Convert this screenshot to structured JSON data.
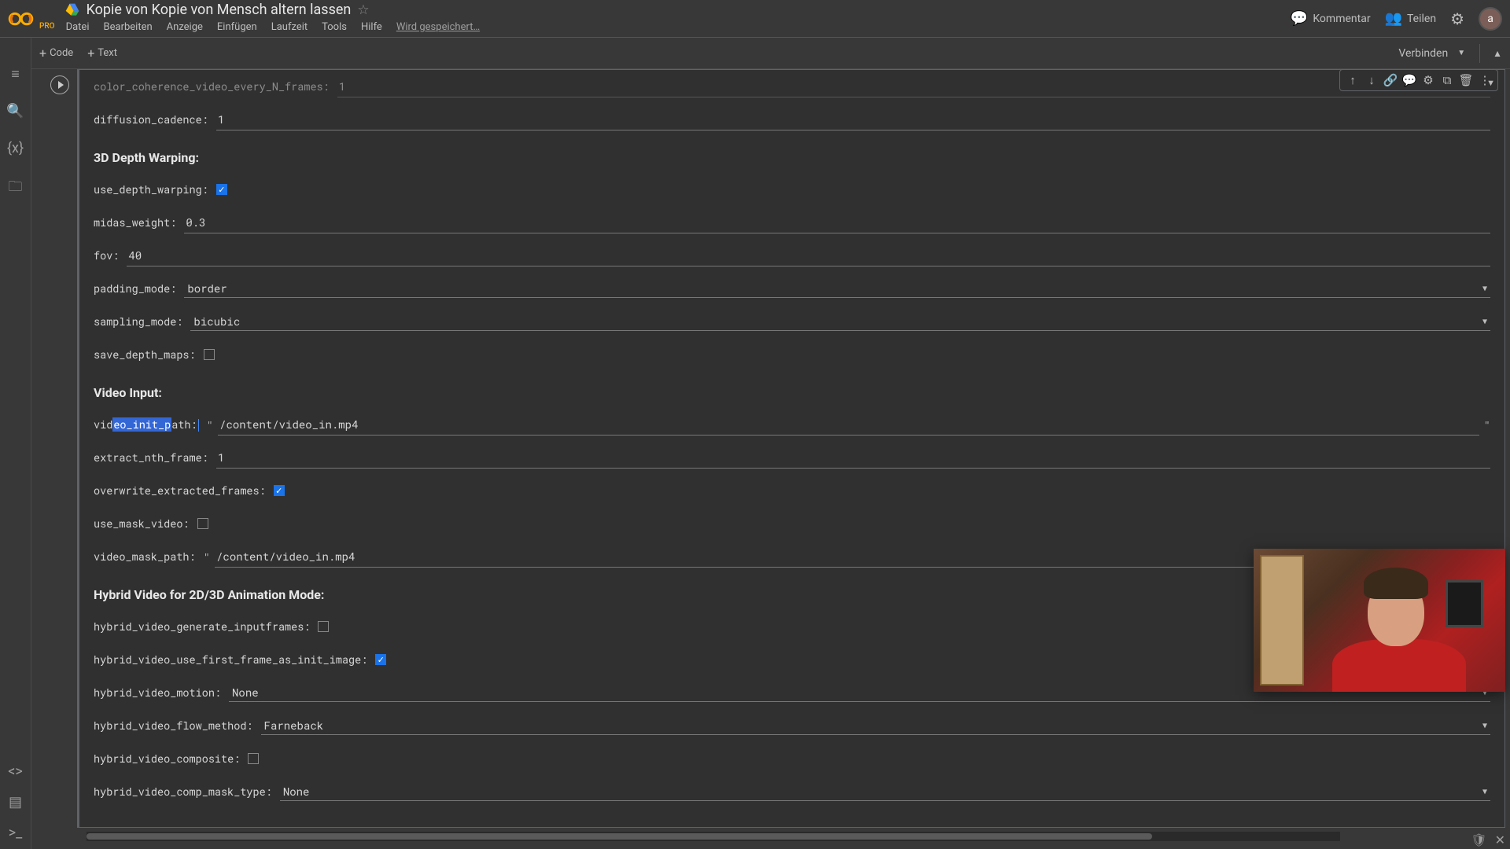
{
  "header": {
    "pro": "PRO",
    "title": "Kopie von Kopie von Mensch altern lassen",
    "menus": [
      "Datei",
      "Bearbeiten",
      "Anzeige",
      "Einfügen",
      "Laufzeit",
      "Tools",
      "Hilfe"
    ],
    "saving": "Wird gespeichert…",
    "kommentar": "Kommentar",
    "teilen": "Teilen",
    "avatar": "a"
  },
  "subbar": {
    "code": "Code",
    "text": "Text",
    "connect": "Verbinden"
  },
  "sections": {
    "depth": "3D Depth Warping:",
    "video": "Video Input:",
    "hybrid": "Hybrid Video for 2D/3D Animation Mode:"
  },
  "fields": {
    "color_coherence_label": "color_coherence_video_every_N_frames:",
    "color_coherence_value": "1",
    "diffusion_cadence_label": "diffusion_cadence:",
    "diffusion_cadence_value": "1",
    "use_depth_warping_label": "use_depth_warping:",
    "midas_weight_label": "midas_weight:",
    "midas_weight_value": "0.3",
    "fov_label": "fov:",
    "fov_value": "40",
    "padding_mode_label": "padding_mode:",
    "padding_mode_value": "border",
    "sampling_mode_label": "sampling_mode:",
    "sampling_mode_value": "bicubic",
    "save_depth_maps_label": "save_depth_maps:",
    "video_init_path_pre": "vid",
    "video_init_path_sel": "eo_init_p",
    "video_init_path_post": "ath:",
    "video_init_path_value": "/content/video_in.mp4",
    "extract_nth_frame_label": "extract_nth_frame:",
    "extract_nth_frame_value": "1",
    "overwrite_extracted_frames_label": "overwrite_extracted_frames:",
    "use_mask_video_label": "use_mask_video:",
    "video_mask_path_label": "video_mask_path:",
    "video_mask_path_value": "/content/video_in.mp4",
    "hybrid_generate_label": "hybrid_video_generate_inputframes:",
    "hybrid_first_frame_label": "hybrid_video_use_first_frame_as_init_image:",
    "hybrid_motion_label": "hybrid_video_motion:",
    "hybrid_motion_value": "None",
    "hybrid_flow_label": "hybrid_video_flow_method:",
    "hybrid_flow_value": "Farneback",
    "hybrid_composite_label": "hybrid_video_composite:",
    "hybrid_mask_type_label": "hybrid_video_comp_mask_type:",
    "hybrid_mask_type_value": "None"
  }
}
